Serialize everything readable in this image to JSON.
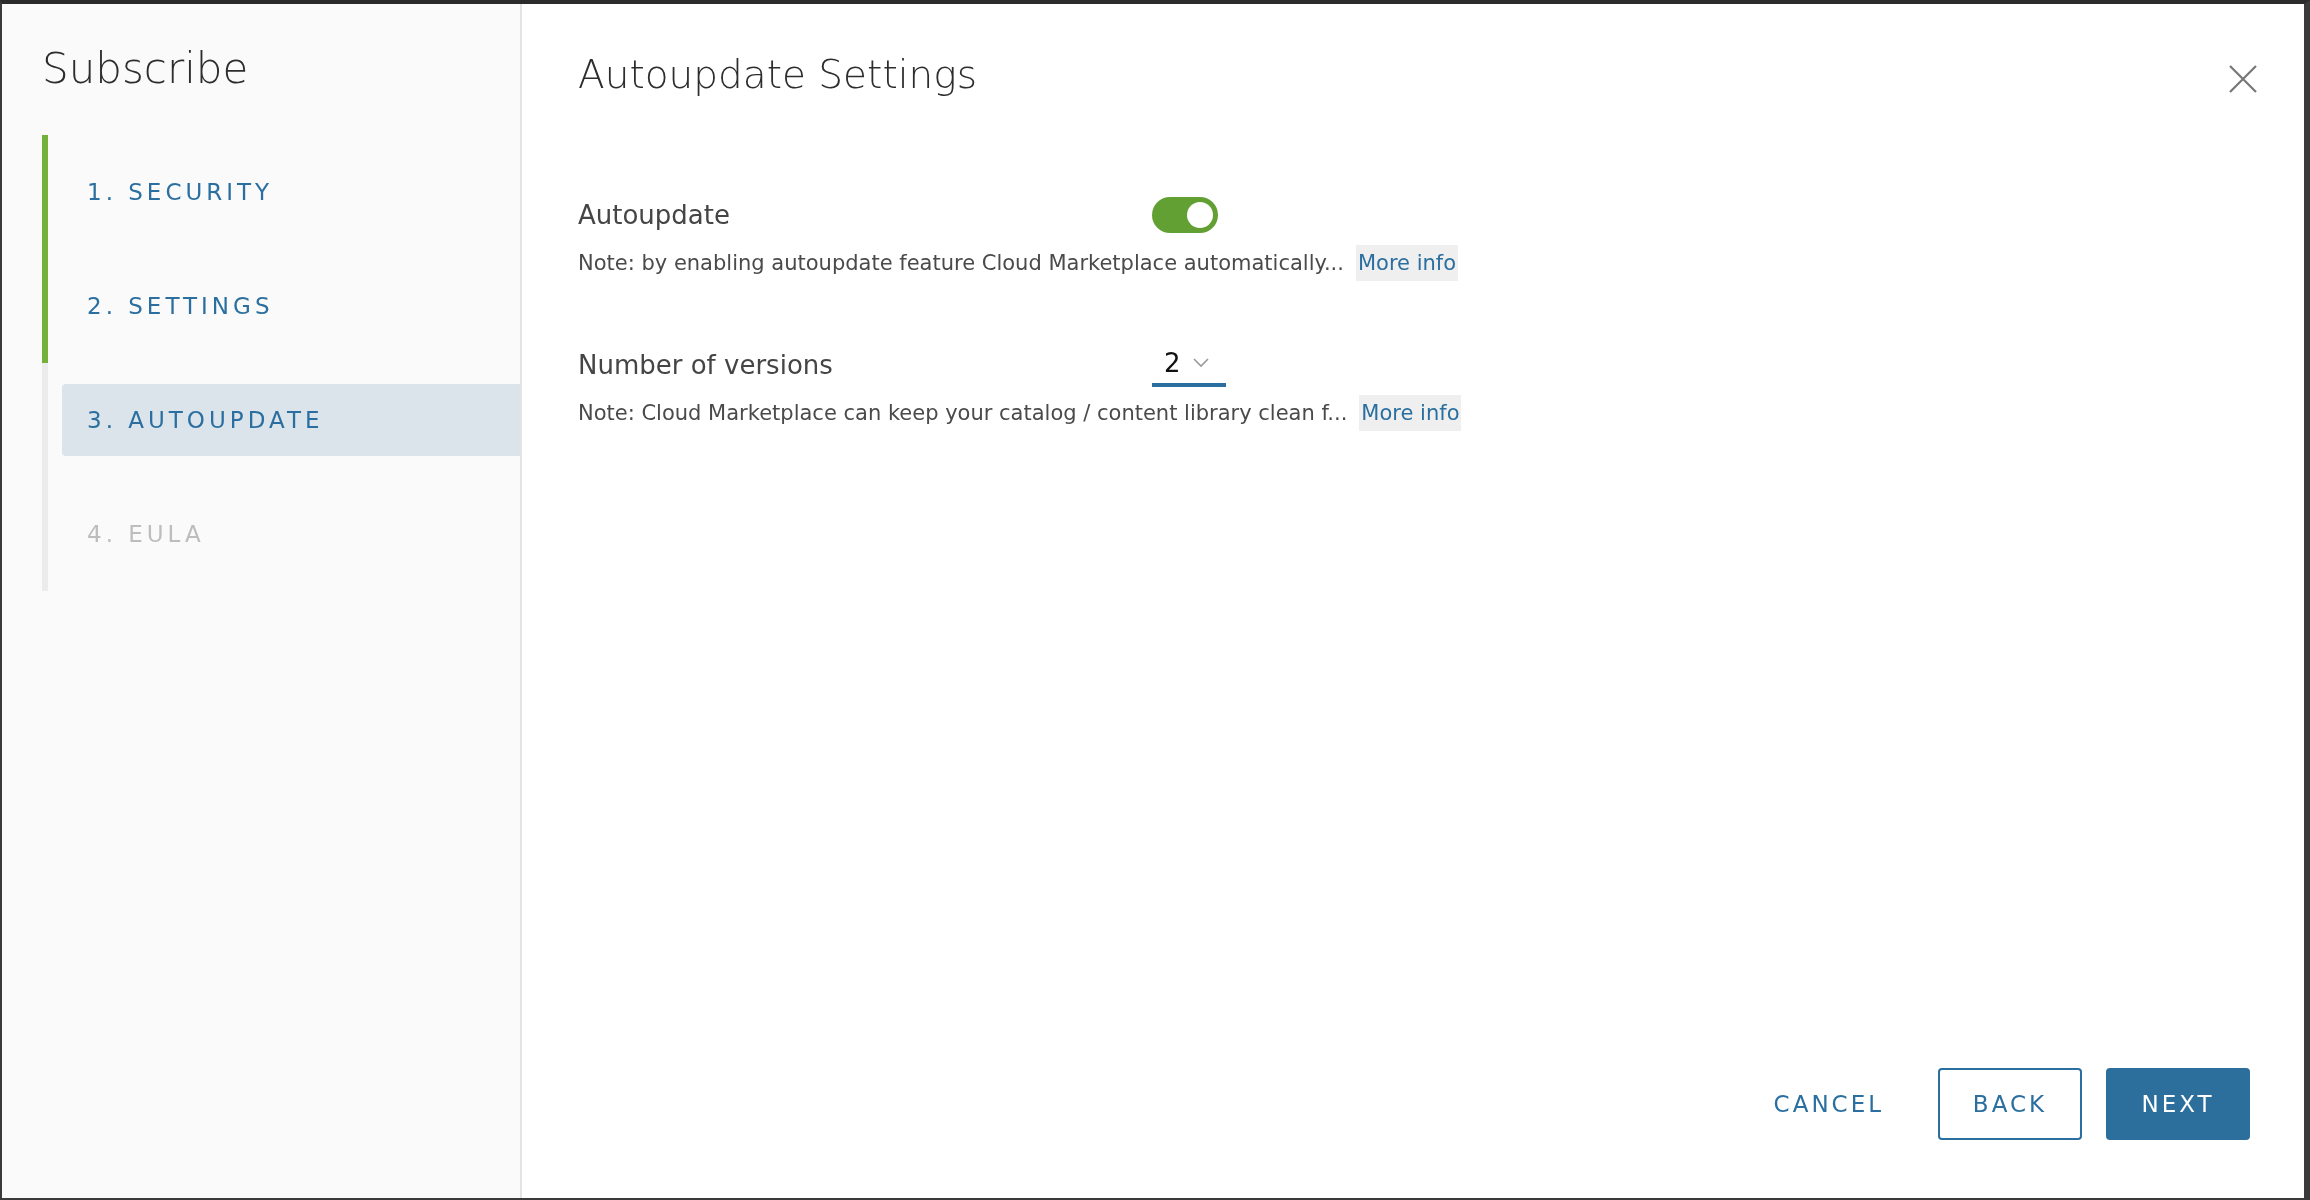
{
  "sidebar": {
    "title": "Subscribe",
    "steps": [
      {
        "label": "1. SECURITY",
        "completed": true,
        "selected": false,
        "disabled": false
      },
      {
        "label": "2. SETTINGS",
        "completed": true,
        "selected": false,
        "disabled": false
      },
      {
        "label": "3. AUTOUPDATE",
        "completed": false,
        "selected": true,
        "disabled": false
      },
      {
        "label": "4. EULA",
        "completed": false,
        "selected": false,
        "disabled": true
      }
    ]
  },
  "main": {
    "title": "Autoupdate Settings",
    "fields": [
      {
        "kind": "toggle",
        "label": "Autoupdate",
        "on": true,
        "note": "Note: by enabling autoupdate feature Cloud Marketplace automatically...",
        "link": "More info"
      },
      {
        "kind": "select",
        "label": "Number of versions",
        "value": "2",
        "note": "Note: Cloud Marketplace can keep your catalog / content library clean f...",
        "link": "More info"
      }
    ]
  },
  "buttons": [
    {
      "label": "CANCEL",
      "kind": "flat"
    },
    {
      "label": "BACK",
      "kind": "outline"
    },
    {
      "label": "NEXT",
      "kind": "primary"
    }
  ]
}
